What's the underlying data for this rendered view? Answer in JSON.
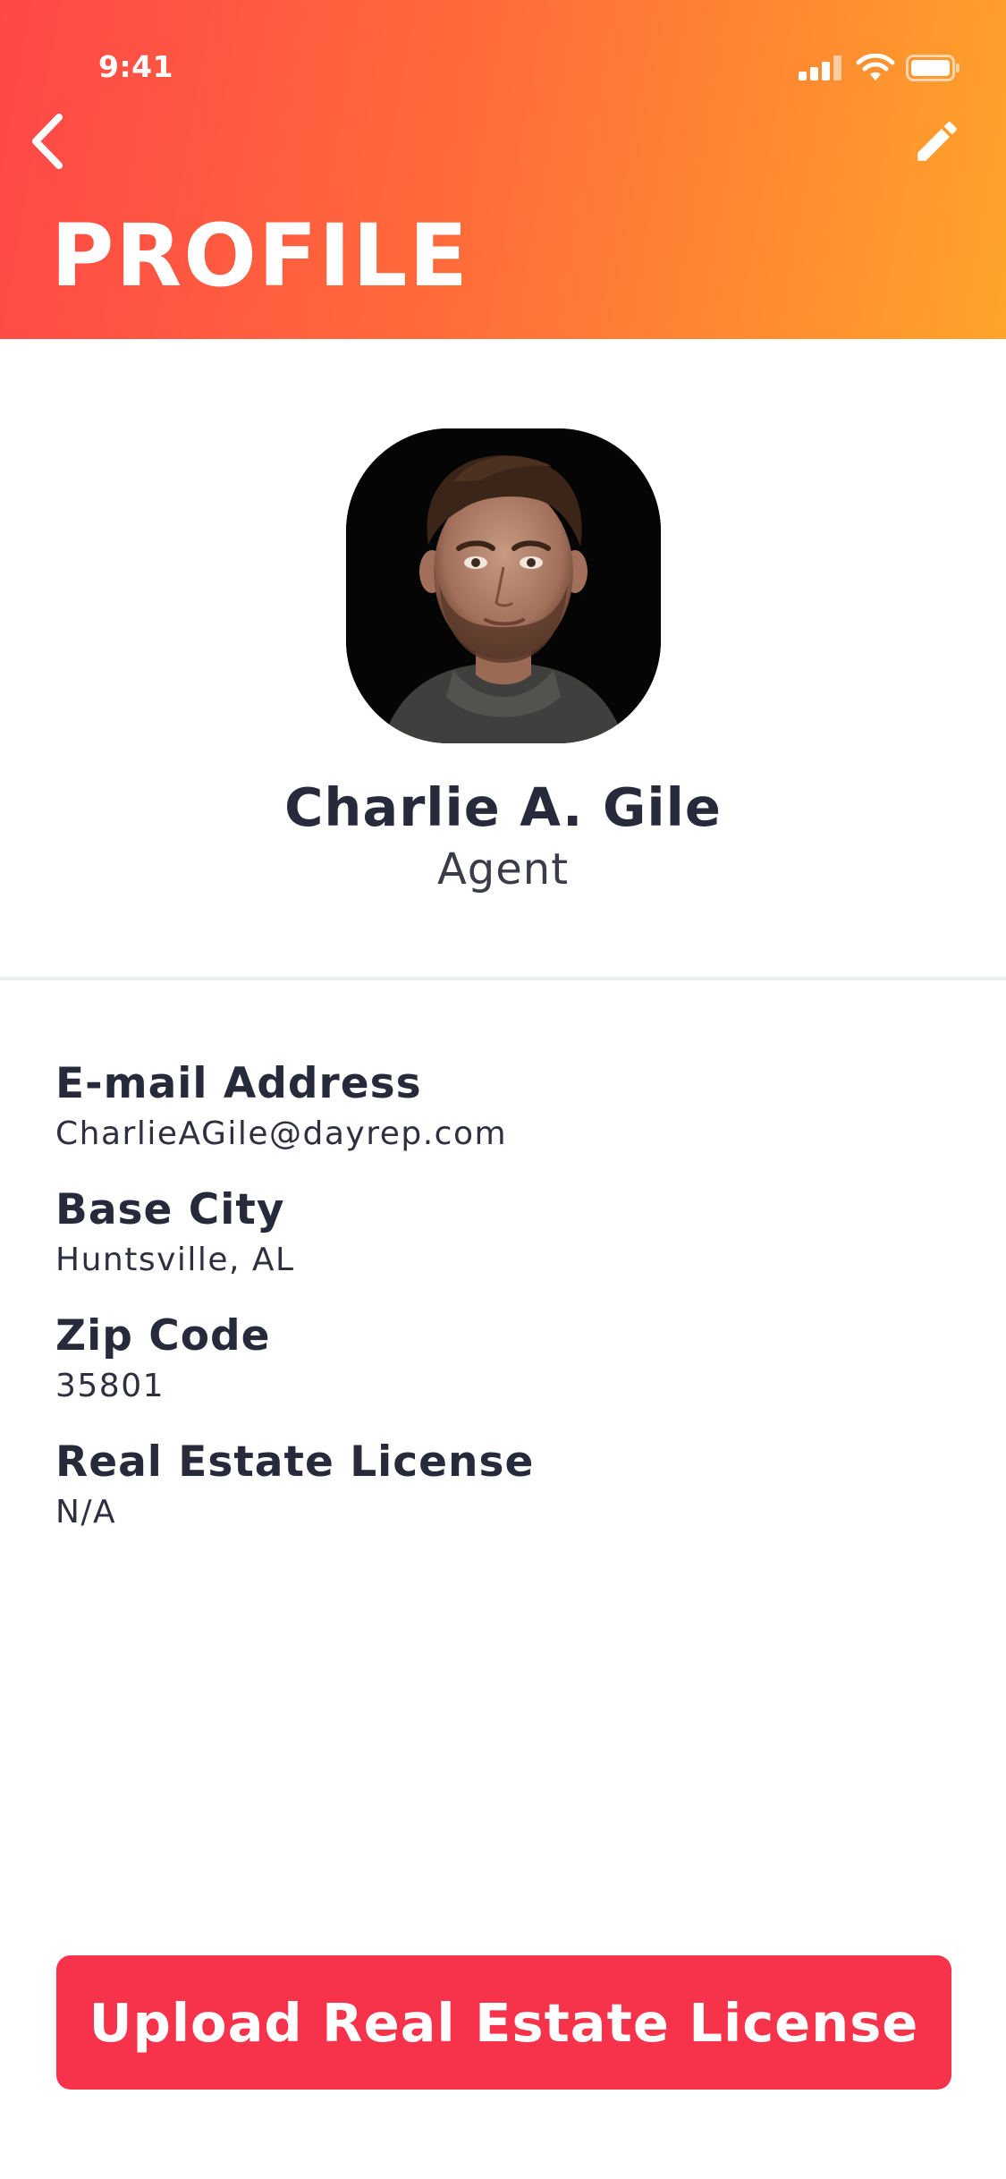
{
  "status_bar": {
    "time": "9:41"
  },
  "header": {
    "title": "PROFILE",
    "back_icon": "chevron-left-icon",
    "edit_icon": "pencil-icon"
  },
  "profile": {
    "name": "Charlie A. Gile",
    "role": "Agent"
  },
  "fields": [
    {
      "label": "E-mail Address",
      "value": "CharlieAGile@dayrep.com"
    },
    {
      "label": "Base City",
      "value": "Huntsville, AL"
    },
    {
      "label": "Zip Code",
      "value": "35801"
    },
    {
      "label": "Real Estate License",
      "value": "N/A"
    }
  ],
  "actions": {
    "upload_label": "Upload Real Estate License"
  },
  "colors": {
    "gradient_start": "#ff4748",
    "gradient_end": "#ffa42a",
    "button": "#f7324b",
    "text_dark": "#272a3a"
  }
}
